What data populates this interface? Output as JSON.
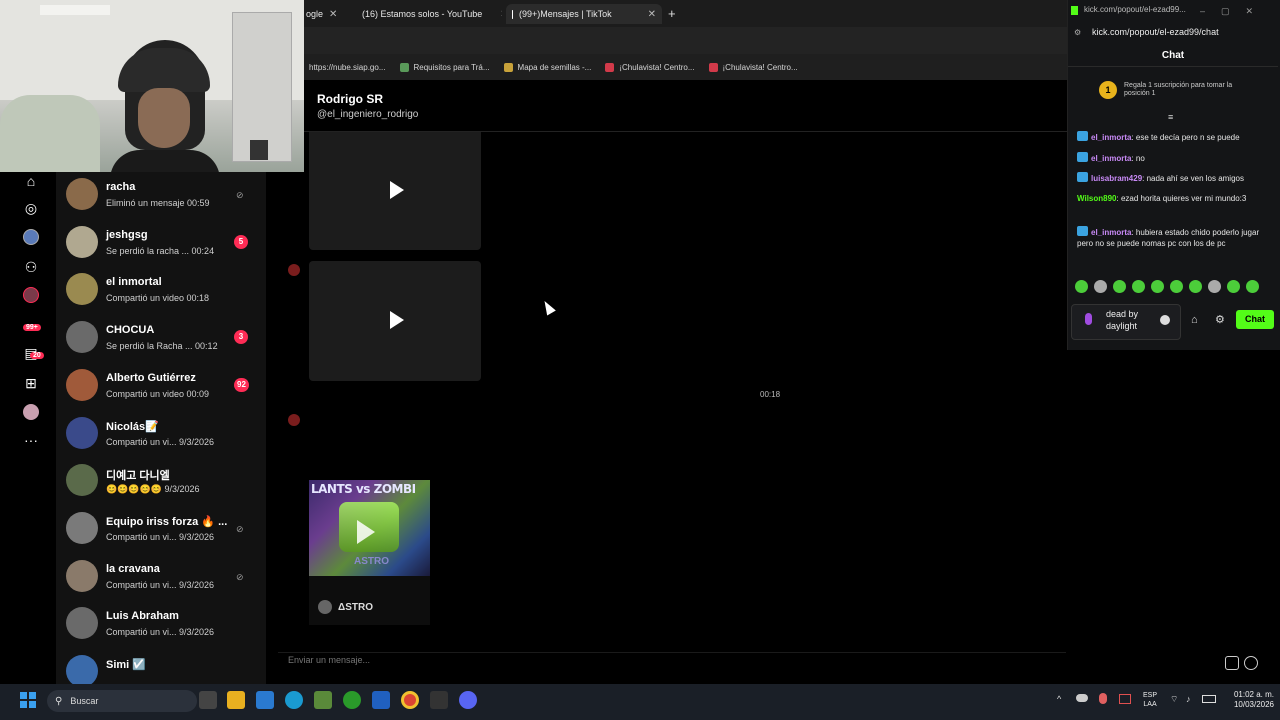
{
  "browser": {
    "tabs": [
      {
        "label": "ogle",
        "icon": "generic-tab-icon"
      },
      {
        "label": "(16) Estamos solos - YouTube",
        "icon": "youtube-icon",
        "color": "#ff0000"
      },
      {
        "label": "(99+)Mensajes | TikTok",
        "icon": "tiktok-icon",
        "color": "#ffffff"
      }
    ],
    "new_tab": "+",
    "bookmarks": [
      {
        "label": "https://nube.siap.go...",
        "color": "#5a5a5a"
      },
      {
        "label": "Requisitos para Trá...",
        "color": "#5a9a5a"
      },
      {
        "label": "Mapa de semillas -...",
        "color": "#c8a23a"
      },
      {
        "label": "¡Chulavista! Centro...",
        "color": "#d23a4a"
      },
      {
        "label": "¡Chulavista! Centro...",
        "color": "#d23a4a"
      }
    ]
  },
  "rail": {
    "badge_messages": "99+",
    "badge_inbox": "20",
    "more": "···"
  },
  "conversations": [
    {
      "name": "racha",
      "sub": "Eliminó un mensaje 00:59",
      "unread": "",
      "muted": true,
      "avatar_color": "#8a6a4a"
    },
    {
      "name": "jeshgsg",
      "sub": "Se perdió la racha ... 00:24",
      "unread": "5",
      "muted": false,
      "avatar_color": "#b0a890"
    },
    {
      "name": "el inmortal",
      "sub": "Compartió un video 00:18",
      "unread": "",
      "muted": false,
      "avatar_color": "#9a8a50"
    },
    {
      "name": "CHOCUA",
      "sub": "Se perdió la Racha ... 00:12",
      "unread": "3",
      "muted": false,
      "avatar_color": "#6a6a6a"
    },
    {
      "name": "Alberto Gutiérrez",
      "sub": "Compartió un video 00:09",
      "unread": "92",
      "muted": false,
      "avatar_color": "#a05a3a"
    },
    {
      "name": "Nicolás📝",
      "sub": "Compartió un vi... 9/3/2026",
      "unread": "",
      "muted": false,
      "avatar_color": "#3a4a8a"
    },
    {
      "name": "디예고 다니엘",
      "sub": "😊😊😊😊😊 9/3/2026",
      "unread": "",
      "muted": false,
      "avatar_color": "#5a6a4a"
    },
    {
      "name": "Equipo iriss forza 🔥 ...",
      "sub": "Compartió un vi... 9/3/2026",
      "unread": "",
      "muted": true,
      "avatar_color": "#7a7a7a"
    },
    {
      "name": "la cravana",
      "sub": "Compartió un vi... 9/3/2026",
      "unread": "",
      "muted": true,
      "avatar_color": "#8a7a6a"
    },
    {
      "name": "Luis Abraham",
      "sub": "Compartió un vi... 9/3/2026",
      "unread": "",
      "muted": false,
      "avatar_color": "#6a6a6a"
    },
    {
      "name": "Simi ☑️",
      "sub": "",
      "unread": "",
      "muted": false,
      "avatar_color": "#3a6aaa"
    }
  ],
  "chat": {
    "contact_name": "Rodrigo SR",
    "contact_handle": "@el_ingeniero_rodrigo",
    "timestamp": "00:18",
    "shared_title": "LANTS vs ZOMBI",
    "shared_brand": "ASTRO",
    "shared_author": "ΔSTRO",
    "input_placeholder": "Enviar un mensaje..."
  },
  "kick": {
    "window_title": "kick.com/popout/el-ezad99...",
    "url": "kick.com/popout/el-ezad99/chat",
    "panel_title": "Chat",
    "promo_text": "Regala 1 suscripción para tomar la posición 1",
    "promo_rank": "1",
    "messages": [
      {
        "user": "el_inmorta",
        "text": ": ese te decía pero n se puede",
        "badge": true,
        "color": "purple"
      },
      {
        "user": "el_inmorta",
        "text": ": no",
        "badge": true,
        "color": "purple"
      },
      {
        "user": "luisabram429",
        "text": ": nada ahí se ven los amigos",
        "badge": true,
        "color": "purple"
      },
      {
        "user": "Wilson890",
        "text": ": ezad horita quieres ver mi mundo:3",
        "badge": false,
        "color": "green"
      },
      {
        "user": "el_inmorta",
        "text": ": hubiera estado chido poderlo jugar pero no se puede nomas pc con los de pc",
        "badge": true,
        "color": "purple"
      }
    ],
    "input_value": "dead by daylight",
    "send_label": "Chat"
  },
  "taskbar": {
    "search_label": "Buscar",
    "lang_top": "ESP",
    "lang_bottom": "LAA",
    "time": "01:02 a. m.",
    "date": "10/03/2026"
  }
}
